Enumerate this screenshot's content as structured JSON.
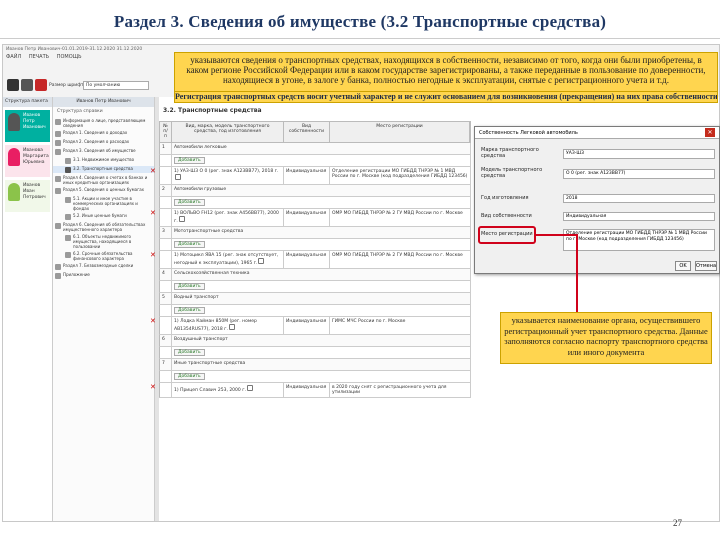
{
  "slide": {
    "title": "Раздел 3. Сведения об имуществе (3.2 Транспортные средства)",
    "page_number": "27"
  },
  "app": {
    "window_title": "Иванов Петр Иванович-01.01.2019-31.12.2020 31.12.2020",
    "menu": [
      "ФАЙЛ",
      "ПЕЧАТЬ",
      "ПОМОЩЬ"
    ],
    "size_label": "Размер шрифта",
    "size_value": "По умолчанию"
  },
  "people": {
    "header": "Структура пакета",
    "items": [
      {
        "name": "Иванов Петр Иванович",
        "color": "#00b0a0"
      },
      {
        "name": "Иванова Маргарита Юрьевна",
        "color": "#e91e63"
      },
      {
        "name": "Иванов Иван Петрович",
        "color": "#8bc34a"
      }
    ]
  },
  "tree": {
    "header": "Иванов Петр Иванович",
    "subheader": "Структура справки",
    "items": [
      "Информация о лице, представляющем сведения",
      "Раздел 1. Сведения о доходах",
      "Раздел 2. Сведения о расходах",
      "Раздел 3. Сведения об имуществе",
      "3.1. Недвижимое имущество",
      "3.2. Транспортные средства",
      "Раздел 4. Сведения о счетах в банках и иных кредитных организациях",
      "Раздел 5. Сведения о ценных бумагах",
      "5.1. Акции и иное участие в коммерческих организациях и фондах",
      "5.2. Иные ценные бумаги",
      "Раздел 6. Сведения об обязательствах имущественного характера",
      "6.1. Объекты недвижимого имущества, находящиеся в пользовании",
      "6.2. Срочные обязательства финансового характера",
      "Раздел 7. Безвозмездные сделки",
      "Приложение"
    ]
  },
  "main": {
    "section_title": "3.2. Транспортные средства",
    "columns": [
      "№ п/п",
      "Вид, марка, модель транспортного средства, год изготовления",
      "Вид собственности",
      "Место регистрации"
    ],
    "add_label": "Добавить",
    "categories": [
      {
        "num": "1",
        "label": "Автомобили легковые",
        "entries": [
          {
            "n": "1)",
            "name": "УАЗ-Ш3 О 0 (рег. знак А123ВВ77), 2018 г.",
            "own": "Индивидуальная",
            "place": "Отделение регистрации МО ГИБДД ТНРЭР № 1 МВД России по г. Москве (код подразделения ГИБДД 123456)"
          }
        ]
      },
      {
        "num": "2",
        "label": "Автомобили грузовые",
        "entries": [
          {
            "n": "1)",
            "name": "ВОЛЬВО FH12 (рег. знак А456ВВ77), 2000 г.",
            "own": "Индивидуальная",
            "place": "ОМР МО ГИБДД ТНРЭР № 2 ГУ МВД России по г. Москве"
          }
        ]
      },
      {
        "num": "3",
        "label": "Мототранспортные средства",
        "entries": [
          {
            "n": "1)",
            "name": "Мотоцикл ЯВА 15 (рег. знак отсутствует, негодный к эксплуатации), 1965 г.",
            "own": "Индивидуальная",
            "place": "ОМР МО ГИБДД ТНРЭР № 2 ГУ МВД России по г. Москве"
          }
        ]
      },
      {
        "num": "4",
        "label": "Сельскохозяйственная техника",
        "entries": []
      },
      {
        "num": "5",
        "label": "Водный транспорт",
        "entries": [
          {
            "n": "1)",
            "name": "Лодка Кайман 850М (рег. номер АВ1354RUS77), 2018 г.",
            "own": "Индивидуальная",
            "place": "ГИМС МЧС России по г. Москве"
          }
        ]
      },
      {
        "num": "6",
        "label": "Воздушный транспорт",
        "entries": []
      },
      {
        "num": "7",
        "label": "Иные транспортные средства",
        "entries": [
          {
            "n": "1)",
            "name": "Прицеп Славич 253, 2000 г.",
            "own": "Индивидуальная",
            "place": "в 2020 году снят с регистрационного учета для утилизации"
          }
        ]
      }
    ]
  },
  "notes": {
    "top": "указываются сведения о транспортных средствах, находящихся в собственности, независимо от того, когда они были приобретены, в каком регионе Российской Федерации или в каком государстве зарегистрированы, а также переданные в пользование по доверенности, находящиеся в угоне, в залоге у банка, полностью негодные к эксплуатации, снятые с регистрационного учета и т.д.",
    "strip": "Регистрация транспортных средств носит учетный характер и не служит основанием для возникновения (прекращения) на них права собственности",
    "bottom": "указывается наименование органа, осуществившего регистрационный учет транспортного средства. Данные заполняются согласно паспорту транспортного средства или иного документа"
  },
  "dialog": {
    "title": "Собственность Легковой автомобиль",
    "labels": [
      "Марка транспортного средства",
      "Модель транспортного средства",
      "Год изготовления",
      "Вид собственности",
      "Место регистрации"
    ],
    "values": [
      "УАЗ-Ш3",
      "О 0 (рег. знак А123ВВ77)",
      "2018",
      "Индивидуальная",
      "Отделение регистрации МО ГИБДД ТНРЭР № 1 МВД России по г. Москве (код подразделения ГИБДД 123456)"
    ],
    "ok": "OK",
    "cancel": "Отмена"
  },
  "colors": {
    "title": "#1f3864",
    "note_bg": "#ffd54f",
    "highlight": "#d0021b",
    "accent_bar": "#5b9bd5"
  }
}
